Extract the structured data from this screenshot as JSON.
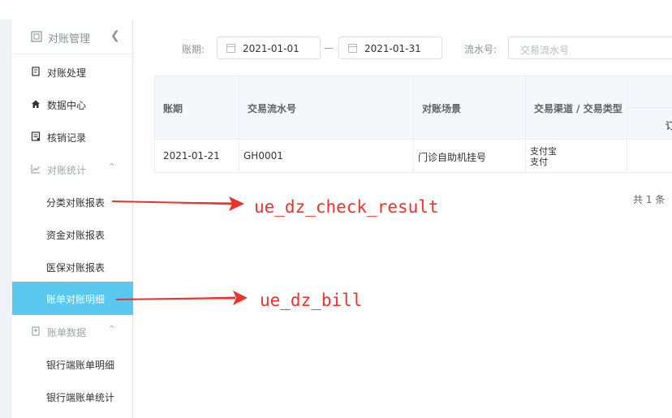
{
  "sidebar": {
    "header_title": "对账管理",
    "items": [
      {
        "label": "对账处理",
        "icon": "doc-icon"
      },
      {
        "label": "数据中心",
        "icon": "home-icon"
      },
      {
        "label": "核销记录",
        "icon": "list-icon"
      },
      {
        "label": "对账统计",
        "icon": "chart-icon",
        "group": true
      },
      {
        "label": "分类对账报表"
      },
      {
        "label": "资金对账报表"
      },
      {
        "label": "医保对账报表"
      },
      {
        "label": "账单对账明细",
        "active": true
      },
      {
        "label": "账单数据",
        "icon": "box-icon",
        "group": true
      },
      {
        "label": "银行端账单明细"
      },
      {
        "label": "银行端账单统计"
      }
    ]
  },
  "filters": {
    "period_label": "账期:",
    "start_date": "2021-01-01",
    "end_date": "2021-01-31",
    "range_sep": "—",
    "serial_label": "流水号:",
    "serial_placeholder": "交易流水号"
  },
  "table": {
    "headers": [
      "账期",
      "交易流水号",
      "对账场景",
      "交易渠道 / 交易类型"
    ],
    "sub_header_partial": "订",
    "rows": [
      {
        "period": "2021-01-21",
        "serial": "GH0001",
        "scene": "门诊自助机挂号",
        "channel_line1": "支付宝",
        "channel_line2": "支付"
      }
    ]
  },
  "pagination": {
    "total_text": "共 1 条"
  },
  "annotations": [
    {
      "label": "ue_dz_check_result"
    },
    {
      "label": "ue_dz_bill"
    }
  ],
  "colors": {
    "active_bg": "#5bc8ef",
    "arrow": "#e8332e"
  }
}
